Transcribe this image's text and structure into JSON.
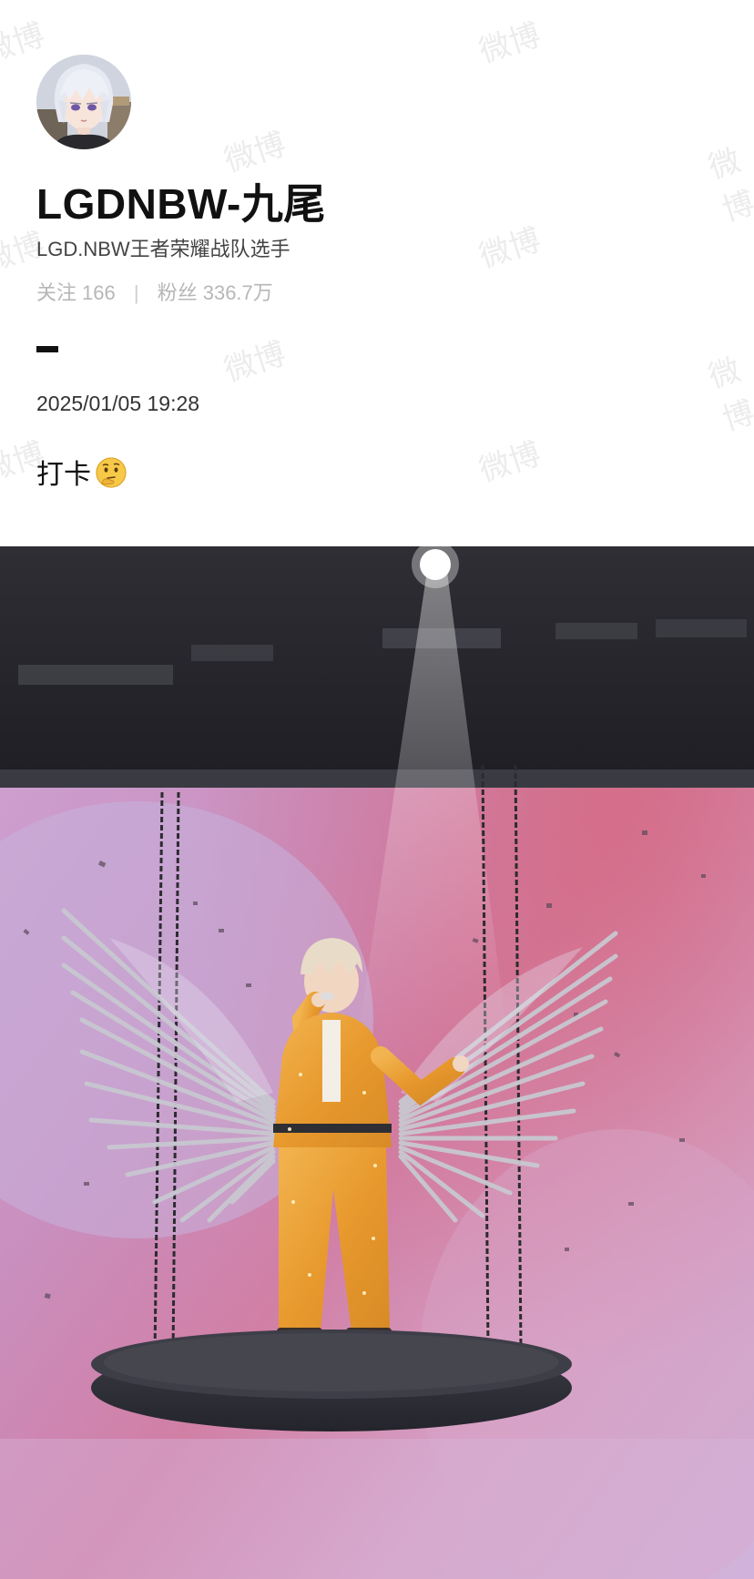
{
  "profile": {
    "username": "LGDNBW-九尾",
    "bio": "LGD.NBW王者荣耀战队选手",
    "following_label": "关注",
    "following_count": "166",
    "separator": "|",
    "followers_label": "粉丝",
    "followers_count": "336.7万"
  },
  "post": {
    "timestamp": "2025/01/05 19:28",
    "text": "打卡",
    "emoji": "thinking-face-icon"
  },
  "watermark": {
    "text": "微博"
  },
  "colors": {
    "username": "#111111",
    "muted": "#b7b7b7",
    "watermark": "#e9e9e9",
    "suit": "#e8a43a",
    "stage_pink": "#d98fc0"
  }
}
